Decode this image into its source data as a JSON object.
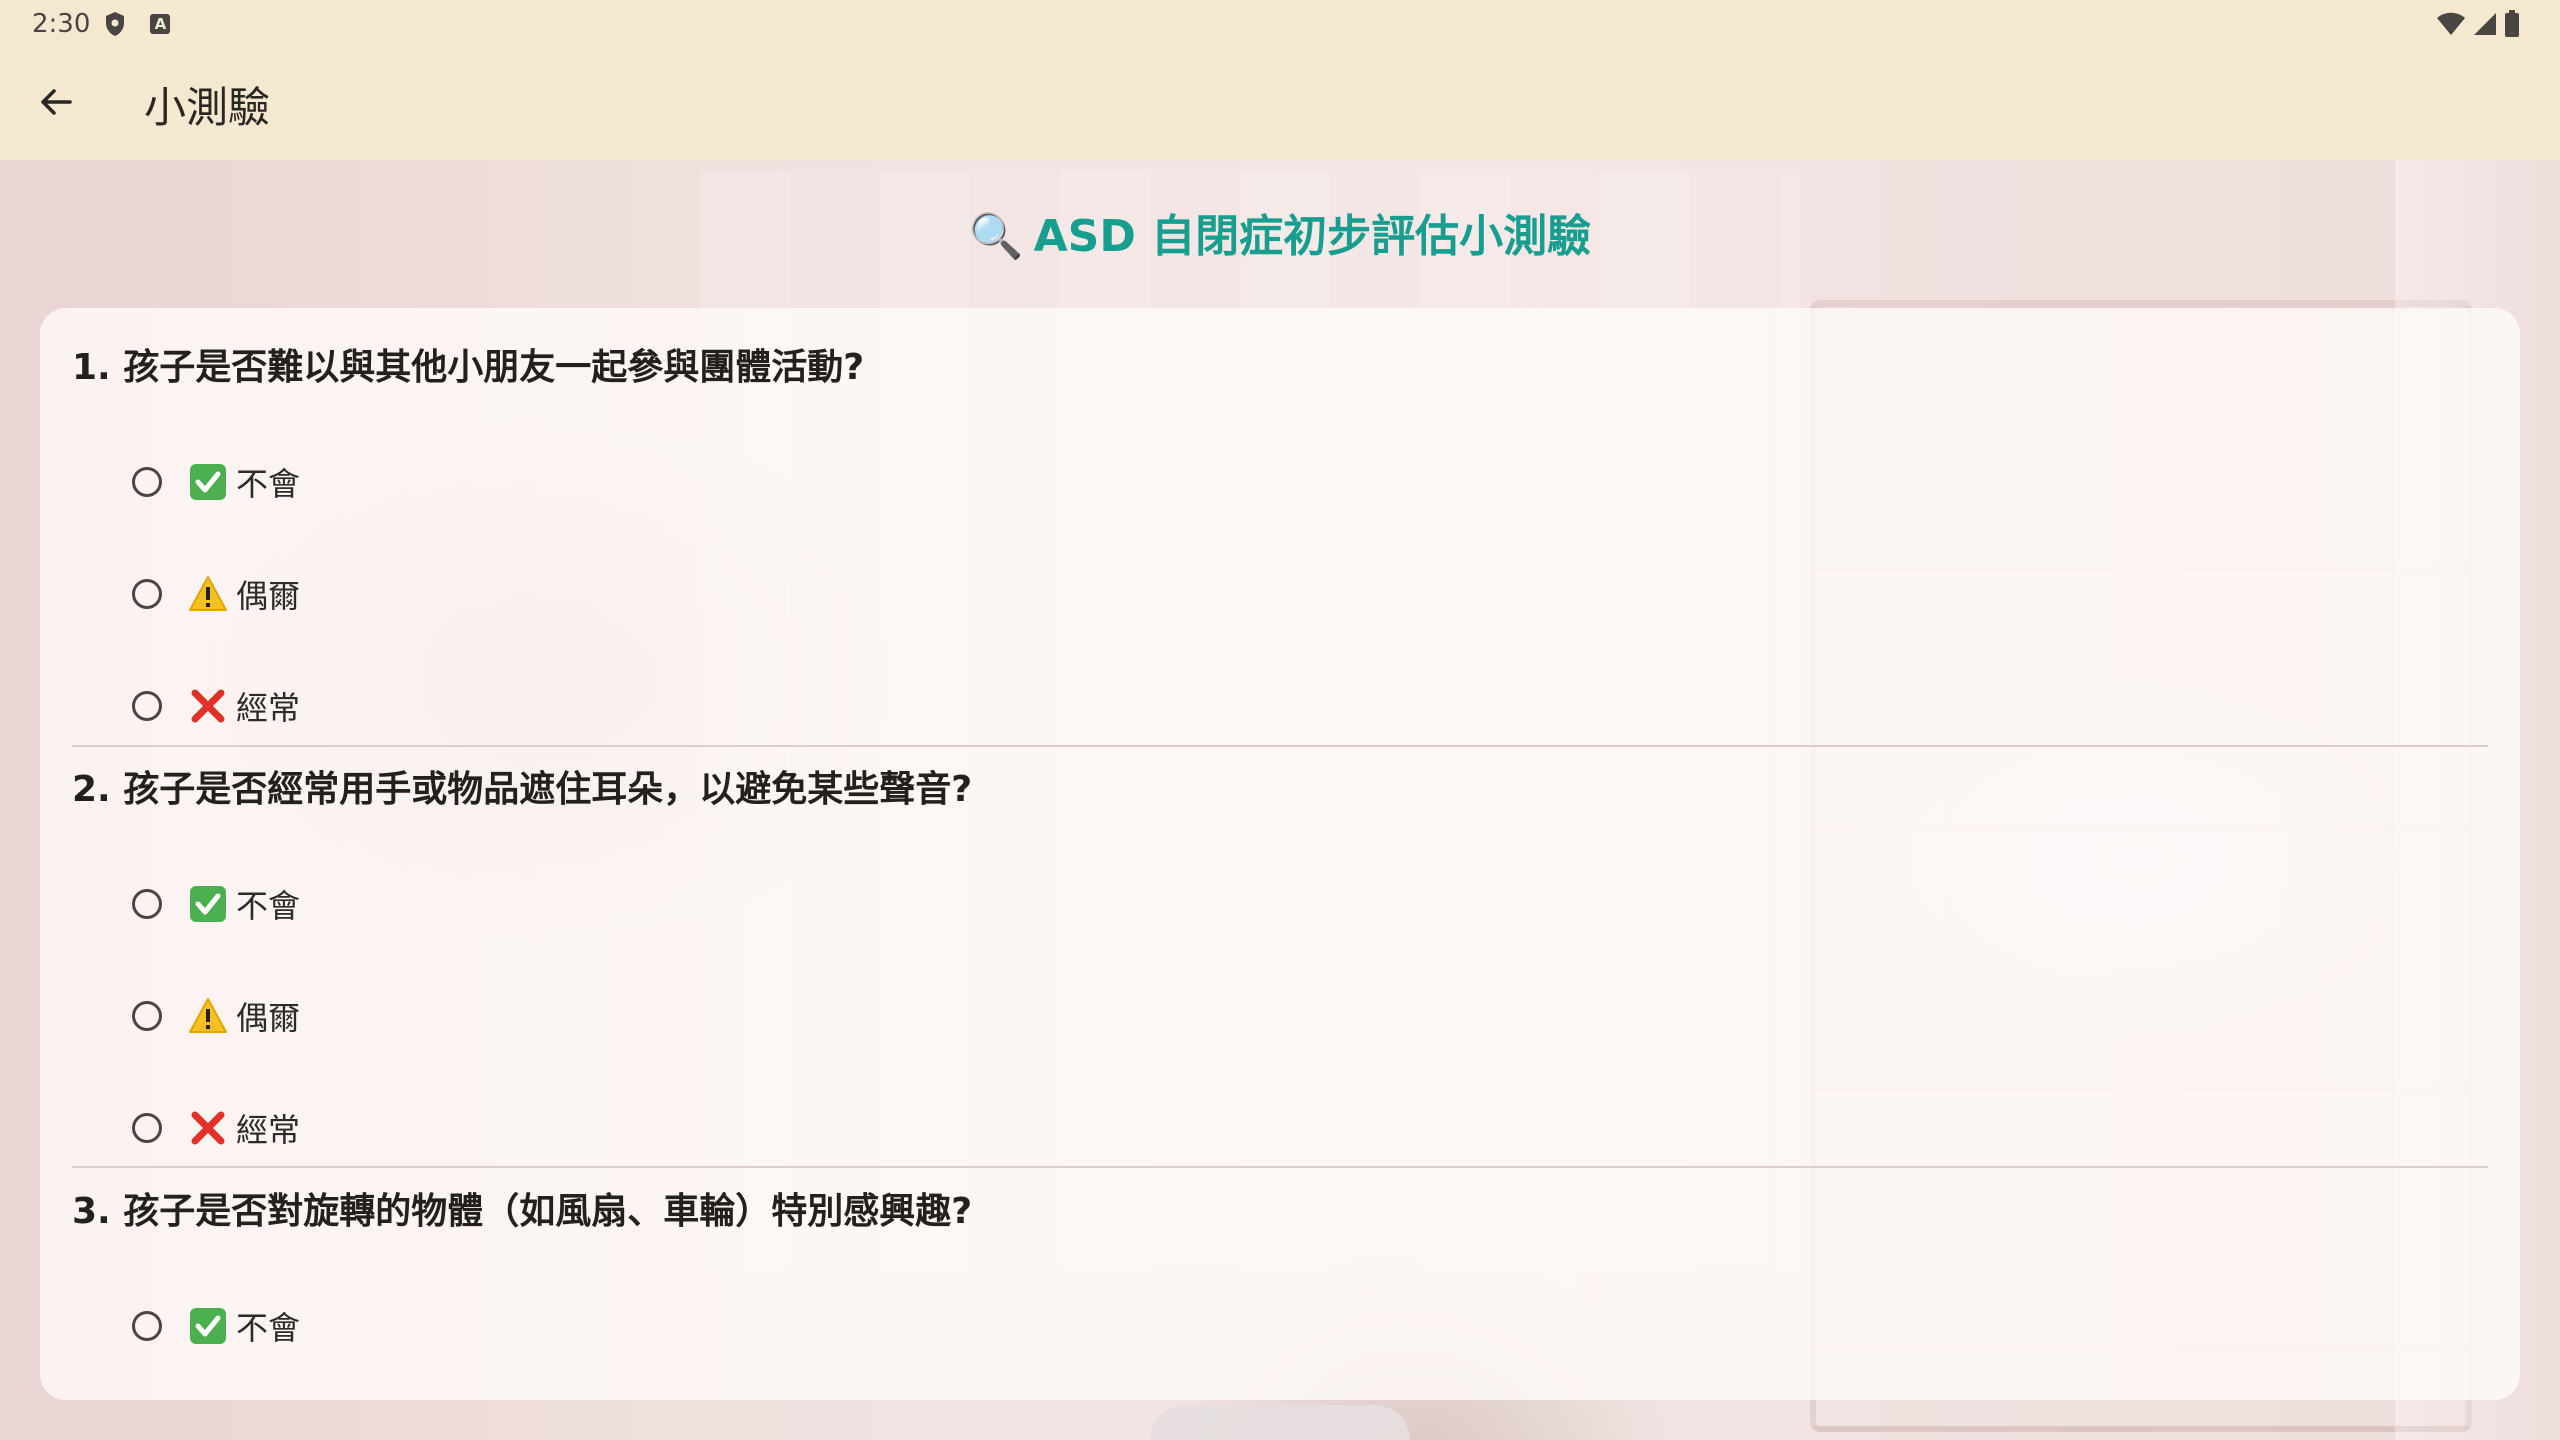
{
  "status_bar": {
    "time": "2:30"
  },
  "app_bar": {
    "title": "小測驗",
    "back_icon": "arrow-back-icon"
  },
  "quiz": {
    "heading_icon": "🔍",
    "heading": "ASD 自閉症初步評估小測驗",
    "questions": [
      {
        "text": "1. 孩子是否難以與其他小朋友一起參與團體活動?",
        "options": [
          {
            "emoji": "check-icon",
            "label": "不會"
          },
          {
            "emoji": "warning-icon",
            "label": "偶爾"
          },
          {
            "emoji": "cross-icon",
            "label": "經常"
          }
        ]
      },
      {
        "text": "2. 孩子是否經常用手或物品遮住耳朵，以避免某些聲音?",
        "options": [
          {
            "emoji": "check-icon",
            "label": "不會"
          },
          {
            "emoji": "warning-icon",
            "label": "偶爾"
          },
          {
            "emoji": "cross-icon",
            "label": "經常"
          }
        ]
      },
      {
        "text": "3. 孩子是否對旋轉的物體（如風扇、車輪）特別感興趣?",
        "options": [
          {
            "emoji": "check-icon",
            "label": "不會"
          }
        ]
      }
    ]
  },
  "colors": {
    "accent": "#179e8f",
    "app_bar": "#f4e8d1"
  }
}
